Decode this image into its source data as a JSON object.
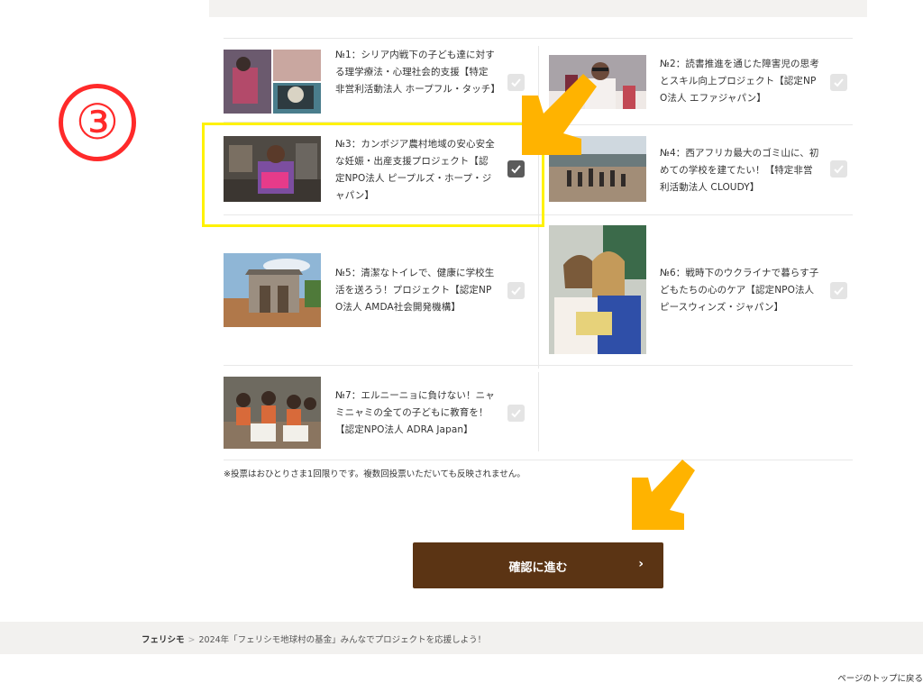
{
  "step_marker": "③",
  "projects": [
    {
      "id": "no1",
      "title": "№1：シリア内戦下の子ども達に対する理学療法・心理社会的支援【特定非営利活動法人 ホープフル・タッチ】",
      "checked": false
    },
    {
      "id": "no2",
      "title": "№2：読書推進を通じた障害児の思考とスキル向上プロジェクト【認定NPO法人 エファジャパン】",
      "checked": false
    },
    {
      "id": "no3",
      "title": "№3：カンボジア農村地域の安心安全な妊娠・出産支援プロジェクト【認定NPO法人 ピープルズ・ホープ・ジャパン】",
      "checked": true
    },
    {
      "id": "no4",
      "title": "№4：西アフリカ最大のゴミ山に、初めての学校を建てたい！【特定非営利活動法人 CLOUDY】",
      "checked": false
    },
    {
      "id": "no5",
      "title": "№5：清潔なトイレで、健康に学校生活を送ろう！プロジェクト【認定NPO法人 AMDA社会開発機構】",
      "checked": false
    },
    {
      "id": "no6",
      "title": "№6：戦時下のウクライナで暮らす子どもたちの心のケア【認定NPO法人 ピースウィンズ・ジャパン】",
      "checked": false
    },
    {
      "id": "no7",
      "title": "№7：エルニーニョに負けない！ニャミニャミの全ての子どもに教育を！【認定NPO法人 ADRA Japan】",
      "checked": false
    }
  ],
  "note": "※投票はおひとりさま1回限りです。複数回投票いただいても反映されません。",
  "confirm_button": {
    "label": "確認に進む",
    "chevron": "›"
  },
  "breadcrumb": {
    "home": "フェリシモ",
    "separator": ">",
    "current": "2024年「フェリシモ地球村の基金」みんなでプロジェクトを応援しよう！"
  },
  "page_top_link": "ページのトップに戻る",
  "colors": {
    "accent_brown": "#5b3414",
    "highlight_yellow": "#fff200",
    "arrow_orange": "#ffb300",
    "step_red": "#ff2a2a"
  },
  "icons": {
    "check": "check-icon",
    "chevron": "chevron-right-icon",
    "arrow": "pointer-arrow"
  }
}
